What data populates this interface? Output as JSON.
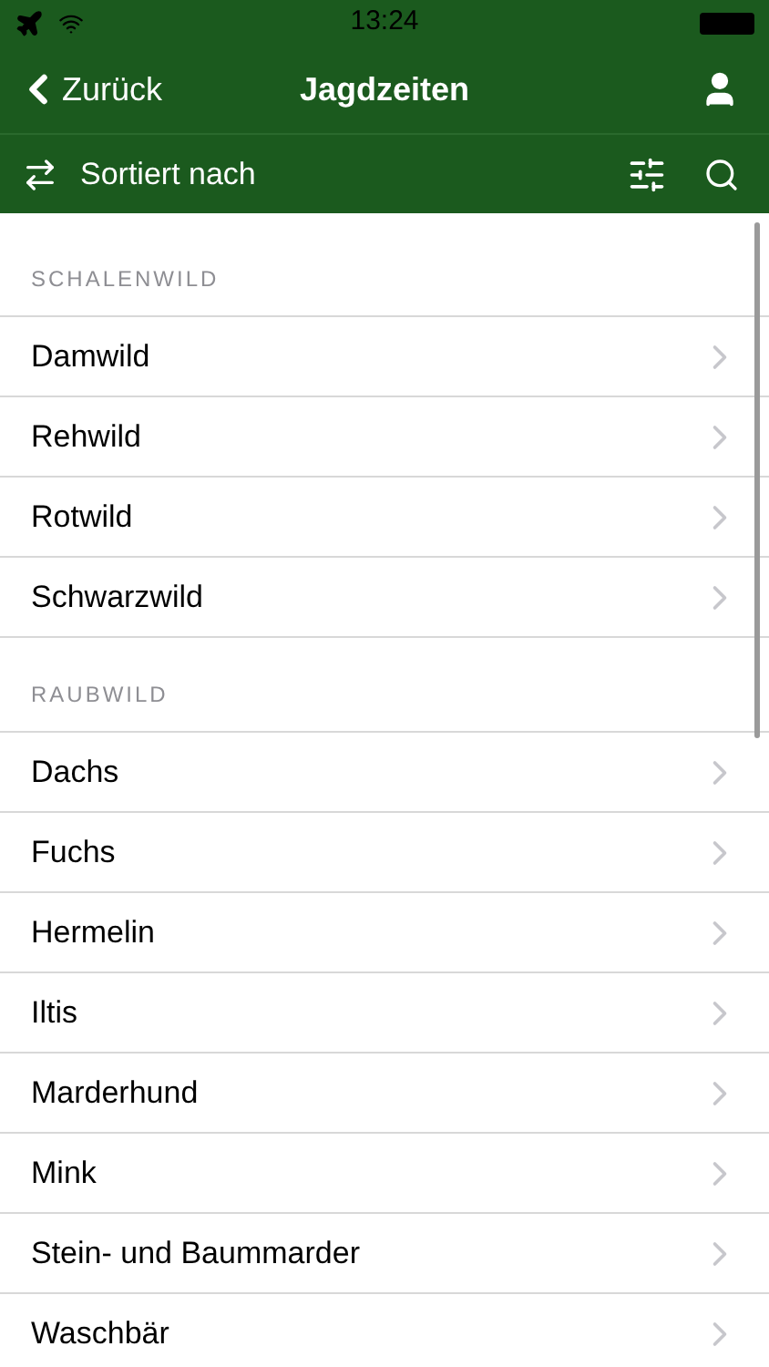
{
  "status_bar": {
    "time": "13:24"
  },
  "nav_bar": {
    "back": "Zurück",
    "title": "Jagdzeiten"
  },
  "sort_bar": {
    "label": "Sortiert nach"
  },
  "sections": [
    {
      "header": "SCHALENWILD",
      "items": [
        "Damwild",
        "Rehwild",
        "Rotwild",
        "Schwarzwild"
      ]
    },
    {
      "header": "RAUBWILD",
      "items": [
        "Dachs",
        "Fuchs",
        "Hermelin",
        "Iltis",
        "Marderhund",
        "Mink",
        "Stein- und Baummarder",
        "Waschbär"
      ]
    }
  ]
}
